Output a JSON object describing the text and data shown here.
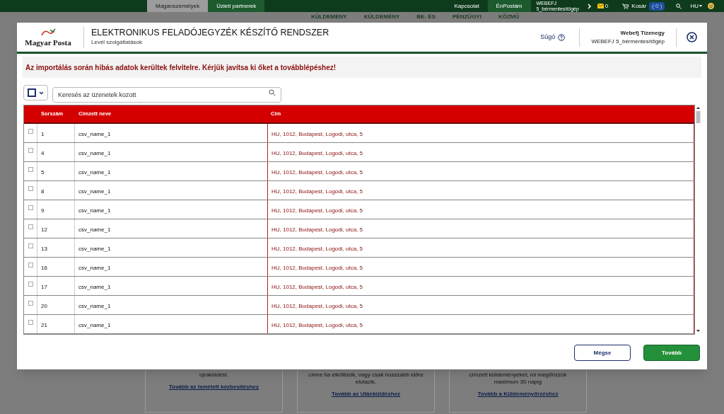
{
  "top_bar": {
    "tabs": [
      {
        "label": "Magánszemélyek",
        "selected": true
      },
      {
        "label": "Üzleti partnerek",
        "selected": false
      }
    ],
    "links": [
      {
        "label": "Kapcsolat",
        "selected": false
      },
      {
        "label": "ÉnPostám",
        "selected": true
      }
    ],
    "account": {
      "line1": "WEBEFJ",
      "line2": "5_bérmentesítőgép"
    },
    "messages_count": "0",
    "cart": {
      "label": "Kosár",
      "count": "( 0 )"
    },
    "language": "HU"
  },
  "background_nav": [
    "KÜLDEMÉNY",
    "KÜLDEMÉNY",
    "BE- ÉS",
    "PÉNZÜGYI",
    "KÖZMŰ"
  ],
  "background_cards": [
    {
      "lines": [
        "újraküldést."
      ],
      "link": "Tovább az Ismételt kézbesítéshez"
    },
    {
      "lines": [
        "címre ha elköltözik, vagy csak hosszabb időre",
        "elutazik."
      ],
      "link": "Tovább az Utánküldéshez"
    },
    {
      "lines": [
        "címzett küldeményeket, mi megőrizzük",
        "maximum 30 napig"
      ],
      "link": "Tovább a Küldeményőrzéshez"
    }
  ],
  "dialog": {
    "logo": "Magyar Posta",
    "title": "ELEKTRONIKUS FELADÓJEGYZÉK KÉSZÍTŐ RENDSZER",
    "subtitle": "Levél szolgáltatások",
    "help": "Súgó",
    "user_name": "Webefj Tizenegy",
    "user_account": "WEBEFJ 5_bérmentesítőgép",
    "error": "Az importálás során hibás adatok kerültek felvitelre. Kérjük javítsa ki őket a továbblépéshez!",
    "select_all_checked": false,
    "search": {
      "placeholder": "Keresés az üzenetek kozott"
    },
    "table": {
      "columns": [
        "Sorszám",
        "Cimzett neve",
        "Cim"
      ],
      "rows": [
        {
          "checked": false,
          "number": "1",
          "name": "csv_name_1",
          "address": "HU, 1012, Budapest, Logodi, utca, 5"
        },
        {
          "checked": false,
          "number": "4",
          "name": "csv_name_1",
          "address": "HU, 1012, Budapest, Logodi, utca, 5"
        },
        {
          "checked": false,
          "number": "5",
          "name": "csv_name_1",
          "address": "HU, 1012, Budapest, Logodi, utca, 5"
        },
        {
          "checked": false,
          "number": "8",
          "name": "csv_name_1",
          "address": "HU, 1012, Budapest, Logodi, utca, 5"
        },
        {
          "checked": false,
          "number": "9",
          "name": "csv_name_1",
          "address": "HU, 1012, Budapest, Logodi, utca, 5"
        },
        {
          "checked": false,
          "number": "12",
          "name": "csv_name_1",
          "address": "HU, 1012, Budapest, Logodi, utca, 5"
        },
        {
          "checked": false,
          "number": "13",
          "name": "csv_name_1",
          "address": "HU, 1012, Budapest, Logodi, utca, 5"
        },
        {
          "checked": false,
          "number": "16",
          "name": "csv_name_1",
          "address": "HU, 1012, Budapest, Logodi, utca, 5"
        },
        {
          "checked": false,
          "number": "17",
          "name": "csv_name_1",
          "address": "HU, 1012, Budapest, Logodi, utca, 5"
        },
        {
          "checked": false,
          "number": "20",
          "name": "csv_name_1",
          "address": "HU, 1012, Budapest, Logodi, utca, 5"
        },
        {
          "checked": false,
          "number": "21",
          "name": "csv_name_1",
          "address": "HU, 1012, Budapest, Logodi, utca, 5"
        }
      ]
    },
    "buttons": [
      {
        "label": "Mégse",
        "kind": "secondary"
      },
      {
        "label": "Tovább",
        "kind": "primary"
      }
    ]
  }
}
